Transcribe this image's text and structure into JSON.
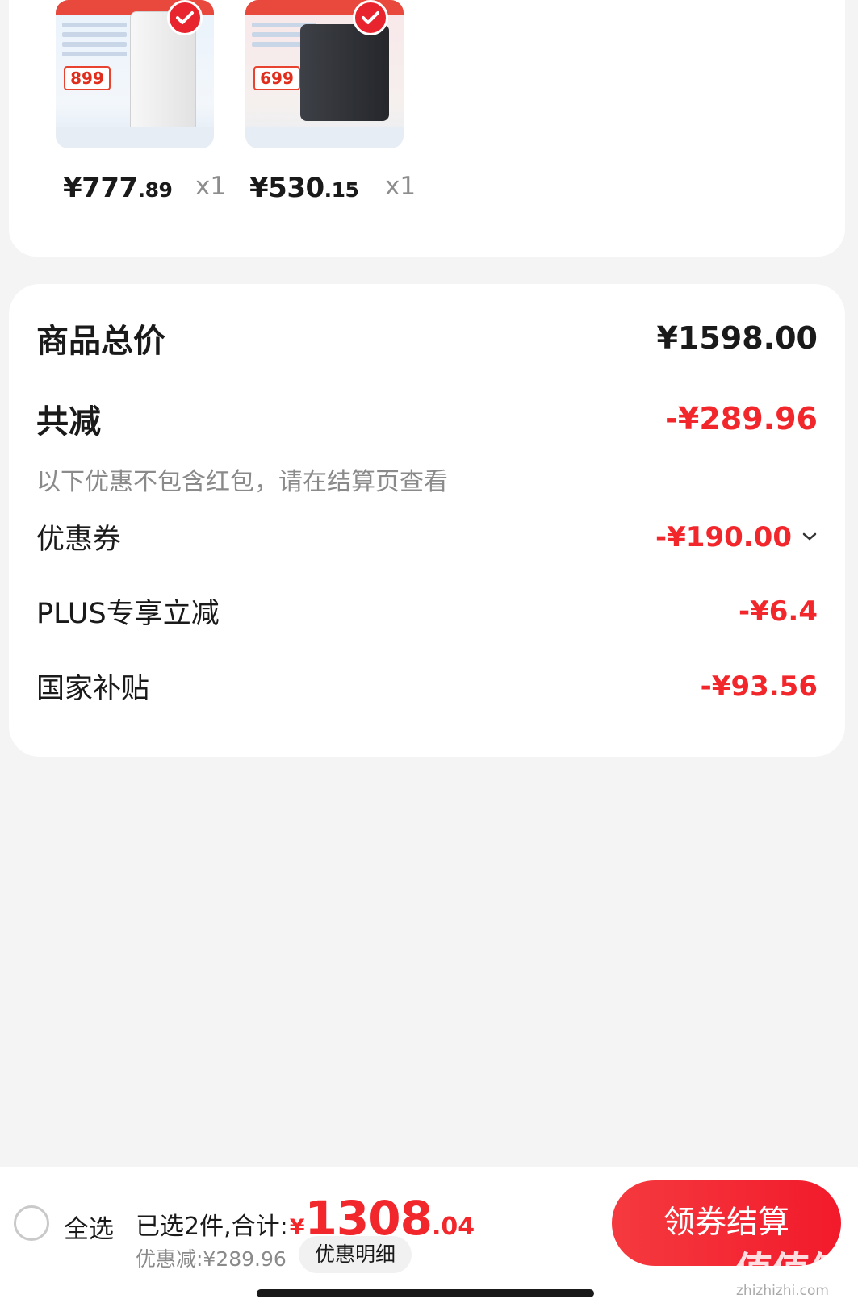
{
  "products": [
    {
      "price_main": "¥777",
      "price_decimal": ".89",
      "qty": "x1",
      "promo_price": "899",
      "selected": true
    },
    {
      "price_main": "¥530",
      "price_decimal": ".15",
      "qty": "x1",
      "promo_price": "699",
      "selected": true
    }
  ],
  "summary": {
    "total_label": "商品总价",
    "total_value": "¥1598.00",
    "reduce_label": "共减",
    "reduce_value": "-¥289.96",
    "note": "以下优惠不包含红包，请在结算页查看",
    "items": [
      {
        "label": "优惠券",
        "value": "-¥190.00"
      },
      {
        "label": "PLUS专享立减",
        "value": "-¥6.4"
      },
      {
        "label": "国家补贴",
        "value": "-¥93.56"
      }
    ]
  },
  "bottom": {
    "select_all": "全选",
    "selected_text": "已选2件,合计:",
    "currency": "¥",
    "total_int": "1308",
    "total_dec": ".04",
    "discount_text": "优惠减:¥289.96",
    "detail_button": "优惠明细",
    "checkout_button": "领券结算"
  },
  "watermark": {
    "text": "值值值",
    "url": "zhizhizhi.com"
  },
  "colors": {
    "accent": "#f2272c",
    "background": "#f4f4f4"
  }
}
